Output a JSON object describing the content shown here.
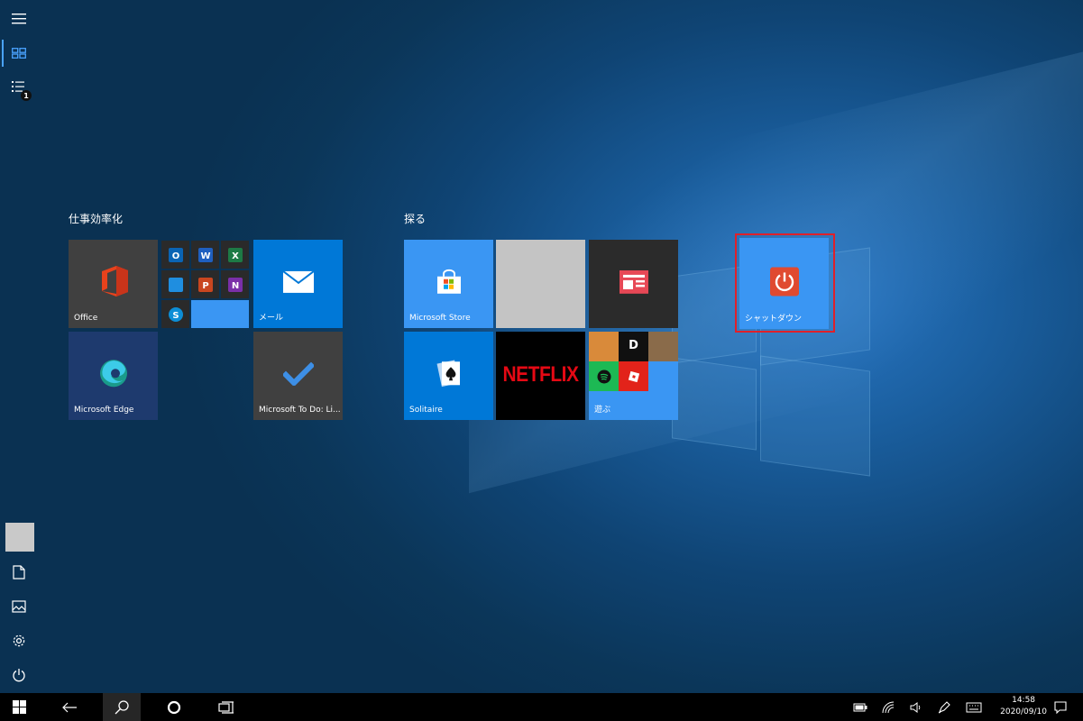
{
  "groups": {
    "productivity": {
      "title": "仕事効率化"
    },
    "explore": {
      "title": "探る"
    }
  },
  "tiles": {
    "office": {
      "label": "Office",
      "icon": "office-icon"
    },
    "mail": {
      "label": "メール",
      "icon": "mail-icon"
    },
    "edge": {
      "label": "Microsoft Edge",
      "icon": "edge-icon"
    },
    "todo": {
      "label": "Microsoft To Do: Li...",
      "icon": "todo-check-icon"
    },
    "store": {
      "label": "Microsoft Store",
      "icon": "store-bag-icon"
    },
    "news": {
      "label": "",
      "icon": "news-icon"
    },
    "solitaire": {
      "label": "Solitaire",
      "icon": "spade-cards-icon"
    },
    "netflix": {
      "label": "NETFLIX"
    },
    "play": {
      "label": "遊ぶ"
    },
    "shutdown": {
      "label": "シャットダウン",
      "icon": "power-icon"
    }
  },
  "office_folder": {
    "apps": [
      {
        "letter": "O",
        "name": "outlook",
        "color": "#0a64b4"
      },
      {
        "letter": "W",
        "name": "word",
        "color": "#1f5fbf"
      },
      {
        "letter": "X",
        "name": "excel",
        "color": "#1d7a45"
      },
      {
        "letter": "",
        "name": "onedrive",
        "color": "#1f8ee0"
      },
      {
        "letter": "P",
        "name": "powerpoint",
        "color": "#c9461f"
      },
      {
        "letter": "N",
        "name": "onenote",
        "color": "#7a2fa8"
      },
      {
        "letter": "S",
        "name": "skype",
        "color": "#0d8ed6"
      }
    ]
  },
  "play_folder": {
    "apps": [
      {
        "name": "candy-crush",
        "color": "#d98a3a"
      },
      {
        "name": "dolby",
        "letter": "D",
        "color": "#101010"
      },
      {
        "name": "strategy-game",
        "color": "#8a6b4a"
      },
      {
        "name": "spotify",
        "color": "#1db954"
      },
      {
        "name": "roblox",
        "color": "#e2231a"
      }
    ]
  },
  "taskbar": {
    "time": "14:58",
    "date": "2020/09/10"
  },
  "colors": {
    "tile_blue": "#0078d7",
    "tile_lightblue": "#3a96f3",
    "tile_dark": "#404040",
    "edge_bg": "#1e3a6e",
    "selection": "#e0202a"
  }
}
